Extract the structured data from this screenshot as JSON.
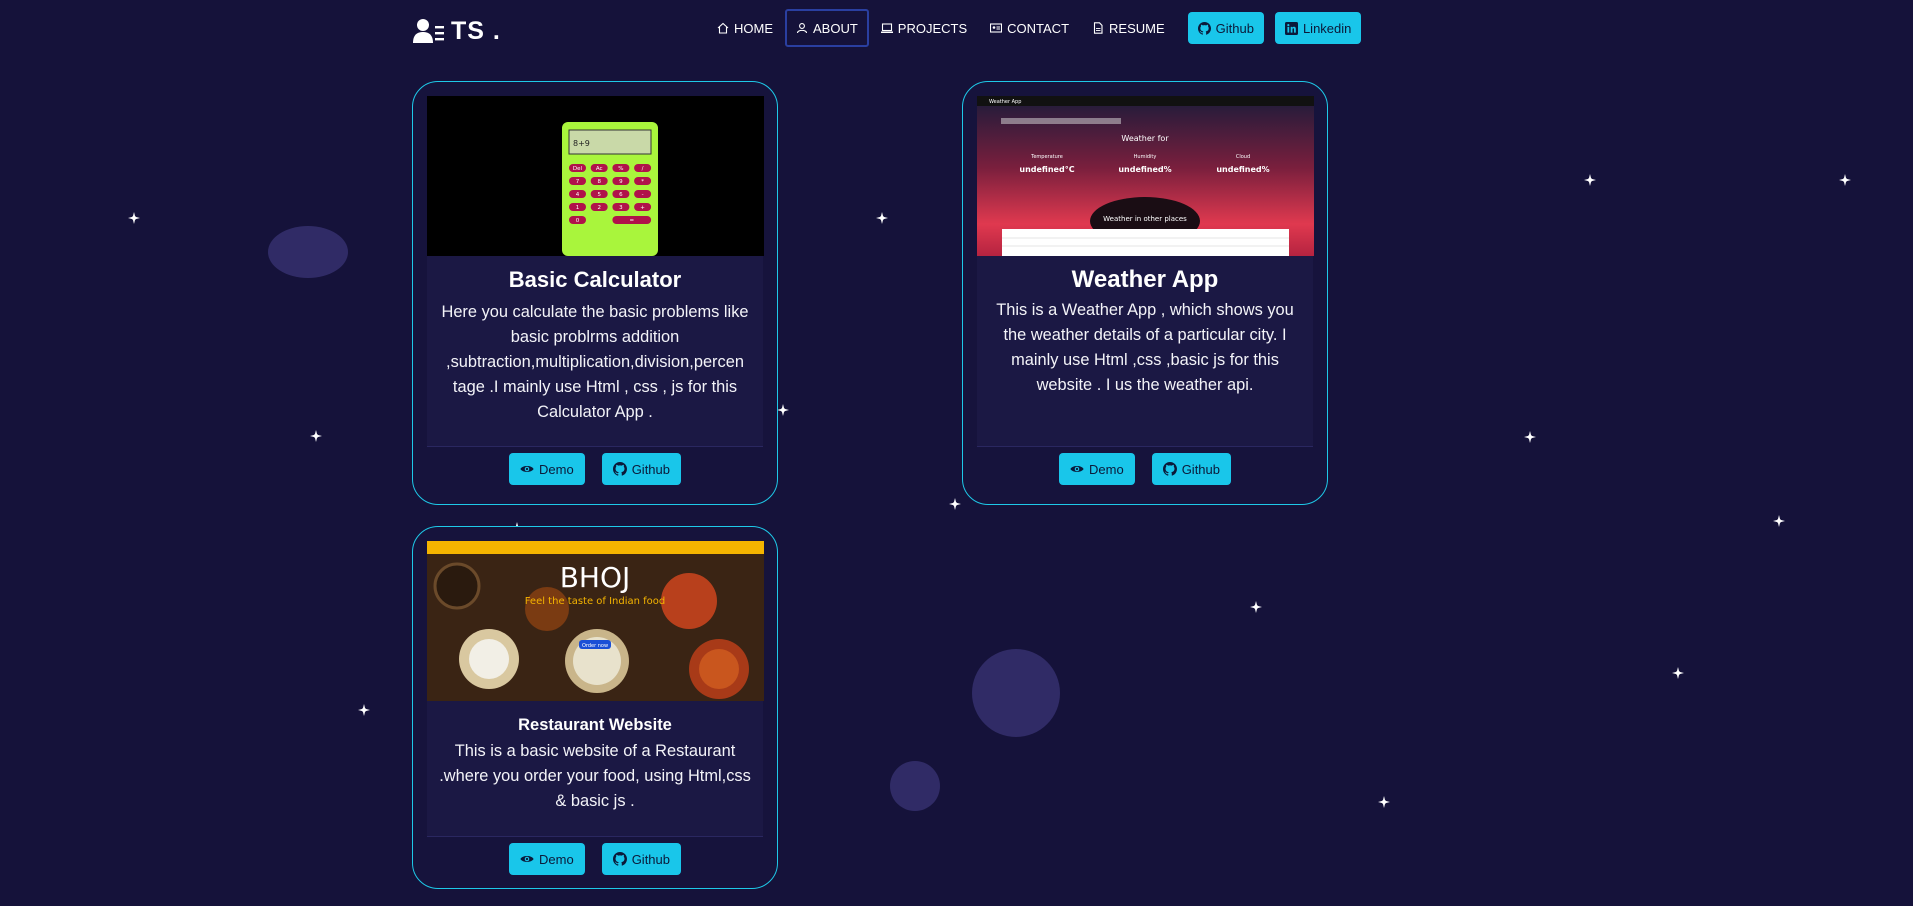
{
  "colors": {
    "background": "#15123a",
    "accent": "#19c6ea",
    "card_border": "#1ec9e8"
  },
  "brand": {
    "name": "TS .",
    "icon": "user-list-icon"
  },
  "nav": {
    "links": [
      {
        "label": "HOME",
        "icon": "home-icon"
      },
      {
        "label": "ABOUT",
        "icon": "user-icon"
      },
      {
        "label": "PROJECTS",
        "icon": "laptop-icon"
      },
      {
        "label": "CONTACT",
        "icon": "id-card-icon"
      },
      {
        "label": "RESUME",
        "icon": "file-icon"
      }
    ],
    "buttons": [
      {
        "label": "Github",
        "icon": "github-icon"
      },
      {
        "label": "Linkedin",
        "icon": "linkedin-icon"
      }
    ]
  },
  "projects": [
    {
      "title": "Basic Calculator",
      "description": "Here you calculate the basic problems like basic problrms addition ,subtraction,multiplication,division,percen tage .I mainly use Html , css , js for this Calculator App .",
      "screenshot": {
        "display": "8+9",
        "keys": [
          "Del",
          "Ac",
          "%",
          "/",
          "7",
          "8",
          "9",
          "*",
          "4",
          "5",
          "6",
          "-",
          "1",
          "2",
          "3",
          "+",
          "0",
          "="
        ]
      },
      "demo_label": "Demo",
      "github_label": "Github"
    },
    {
      "title": "Weather App",
      "description": "This is a Weather App , which shows you the weather details of a particular city. I mainly use Html ,css ,basic js for this website . I us the weather api.",
      "screenshot": {
        "app_name": "Weather App",
        "heading": "Weather for",
        "cols": [
          "Temperature",
          "Humidity",
          "Cloud"
        ],
        "values": [
          "undefined°C",
          "undefined%",
          "undefined%"
        ],
        "subheading": "Weather in other places"
      },
      "demo_label": "Demo",
      "github_label": "Github"
    },
    {
      "title": "Restaurant Website",
      "description": "This is a basic website of a Restaurant .where you order your food, using Html,css & basic js .",
      "screenshot": {
        "brand": "BHOJ",
        "tagline": "Feel the taste of Indian food",
        "cta": "Order now"
      },
      "demo_label": "Demo",
      "github_label": "Github"
    }
  ]
}
